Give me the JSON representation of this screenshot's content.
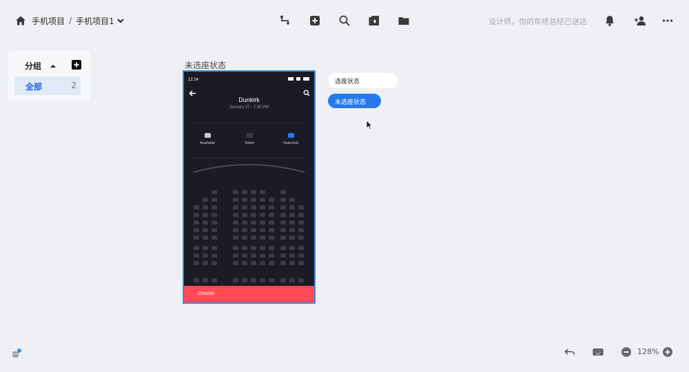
{
  "breadcrumb": {
    "project": "手机项目",
    "separator": "/",
    "page": "手机项目1"
  },
  "notice": "设计师，你的年终总结已送达",
  "groups": {
    "heading": "分组",
    "items": [
      {
        "label": "全部",
        "count": "2"
      }
    ]
  },
  "artboard": {
    "title": "未选座状态",
    "status_time": "12:14",
    "movie_title": "Dunkirk",
    "movie_date": "January 27 - 7:30 PM",
    "legend": [
      {
        "label": "Available",
        "color": "#c8c8d2"
      },
      {
        "label": "Token",
        "color": "#3a3b47"
      },
      {
        "label": "Selected",
        "color": "#2578ee"
      }
    ],
    "choose_label": "Choose"
  },
  "components": {
    "selected_state": "选座状态",
    "unselected_state": "未选座状态"
  },
  "zoom": "128%",
  "colors": {
    "accent": "#2578ee",
    "choose_bar": "#ff4a57",
    "phone_bg": "#1b1b25",
    "selection_border": "#3a8dde"
  }
}
